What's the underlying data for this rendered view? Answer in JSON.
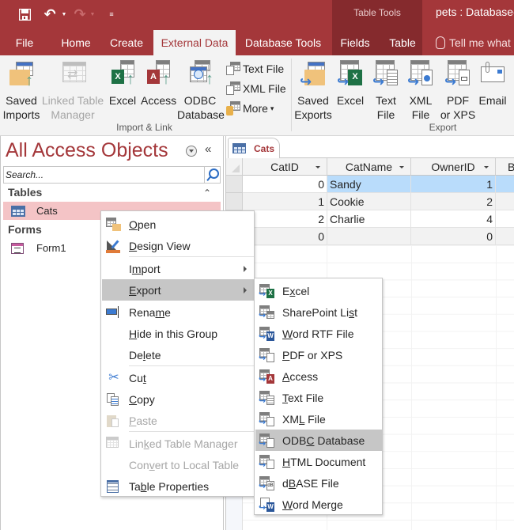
{
  "window": {
    "title": "pets : Database-",
    "contextual_group": "Table Tools",
    "accent": "#a4373a"
  },
  "quick_access": {
    "save": "save-icon",
    "undo": "undo-icon",
    "redo": "redo-icon",
    "customize": "customize-qat-icon"
  },
  "tabs": [
    {
      "label": "File"
    },
    {
      "label": "Home"
    },
    {
      "label": "Create"
    },
    {
      "label": "External Data",
      "active": true
    },
    {
      "label": "Database Tools"
    },
    {
      "label": "Fields"
    },
    {
      "label": "Table"
    }
  ],
  "tell_me": "Tell me what",
  "ribbon": {
    "import_link": {
      "label": "Import & Link",
      "buttons": [
        {
          "line1": "Saved",
          "line2": "Imports"
        },
        {
          "line1": "Linked Table",
          "line2": "Manager",
          "disabled": true
        },
        {
          "line1": "Excel",
          "line2": ""
        },
        {
          "line1": "Access",
          "line2": ""
        },
        {
          "line1": "ODBC",
          "line2": "Database"
        }
      ],
      "small_buttons": [
        {
          "label": "Text File"
        },
        {
          "label": "XML File"
        },
        {
          "label": "More",
          "dropdown": "▾"
        }
      ]
    },
    "export": {
      "label": "Export",
      "buttons": [
        {
          "line1": "Saved",
          "line2": "Exports"
        },
        {
          "line1": "Excel",
          "line2": ""
        },
        {
          "line1": "Text",
          "line2": "File"
        },
        {
          "line1": "XML",
          "line2": "File"
        },
        {
          "line1": "PDF",
          "line2": "or XPS"
        },
        {
          "line1": "Email",
          "line2": ""
        }
      ]
    }
  },
  "nav_pane": {
    "title": "All Access Objects",
    "collapse": "«",
    "search_placeholder": "Search...",
    "sections": [
      {
        "header": "Tables",
        "toggle": "⌃",
        "items": [
          {
            "label": "Cats",
            "selected": true
          }
        ]
      },
      {
        "header": "Forms",
        "items": [
          {
            "label": "Form1"
          }
        ]
      }
    ]
  },
  "document": {
    "tab_label": "Cats",
    "columns": [
      "CatID",
      "CatName",
      "OwnerID",
      "B"
    ],
    "rows": [
      {
        "CatID": "0",
        "CatName": "Sandy",
        "OwnerID": "1"
      },
      {
        "CatID": "1",
        "CatName": "Cookie",
        "OwnerID": "2"
      },
      {
        "CatID": "2",
        "CatName": "Charlie",
        "OwnerID": "4"
      },
      {
        "CatID": "0",
        "CatName": "",
        "OwnerID": "0"
      }
    ]
  },
  "context_menu": {
    "items": [
      {
        "pre": "",
        "u": "O",
        "post": "pen",
        "icon": "open-icon"
      },
      {
        "pre": "",
        "u": "D",
        "post": "esign View",
        "icon": "design-view-icon"
      },
      {
        "pre": "I",
        "u": "m",
        "post": "port",
        "submenu": true
      },
      {
        "pre": "",
        "u": "E",
        "post": "xport",
        "submenu": true,
        "hot": true
      },
      {
        "pre": "Rena",
        "u": "m",
        "post": "e",
        "icon": "rename-icon"
      },
      {
        "pre": "",
        "u": "H",
        "post": "ide in this Group"
      },
      {
        "pre": "De",
        "u": "l",
        "post": "ete"
      },
      {
        "pre": "Cu",
        "u": "t",
        "post": "",
        "icon": "cut-icon"
      },
      {
        "pre": "",
        "u": "C",
        "post": "opy",
        "icon": "copy-icon"
      },
      {
        "pre": "",
        "u": "P",
        "post": "aste",
        "icon": "paste-icon",
        "disabled": true
      },
      {
        "pre": "Lin",
        "u": "k",
        "post": "ed Table Manager",
        "icon": "linked-table-manager-icon",
        "disabled": true
      },
      {
        "pre": "Con",
        "u": "v",
        "post": "ert to Local Table",
        "disabled": true
      },
      {
        "pre": "Ta",
        "u": "b",
        "post": "le Properties",
        "icon": "table-properties-icon"
      }
    ]
  },
  "export_submenu": {
    "items": [
      {
        "pre": "E",
        "u": "x",
        "post": "cel",
        "icon": "excel-icon"
      },
      {
        "pre": "SharePoint Li",
        "u": "s",
        "post": "t",
        "icon": "sharepoint-list-icon"
      },
      {
        "pre": "",
        "u": "W",
        "post": "ord RTF File",
        "icon": "word-rtf-icon"
      },
      {
        "pre": "",
        "u": "P",
        "post": "DF or XPS",
        "icon": "pdf-xps-icon"
      },
      {
        "pre": "",
        "u": "A",
        "post": "ccess",
        "icon": "access-icon"
      },
      {
        "pre": "",
        "u": "T",
        "post": "ext File",
        "icon": "text-file-icon"
      },
      {
        "pre": "XM",
        "u": "L",
        "post": " File",
        "icon": "xml-file-icon"
      },
      {
        "pre": "ODB",
        "u": "C",
        "post": " Database",
        "icon": "odbc-database-icon",
        "hot": true
      },
      {
        "pre": "",
        "u": "H",
        "post": "TML Document",
        "icon": "html-document-icon"
      },
      {
        "pre": "d",
        "u": "B",
        "post": "ASE File",
        "icon": "dbase-file-icon"
      },
      {
        "pre": "",
        "u": "W",
        "post": "ord Merge",
        "icon": "word-merge-icon"
      }
    ]
  }
}
